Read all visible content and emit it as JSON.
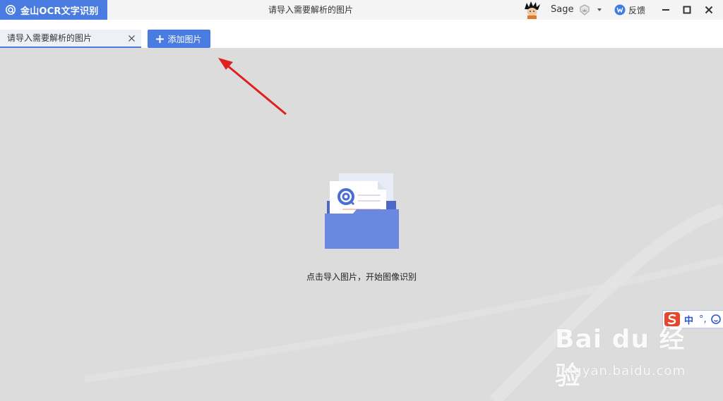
{
  "app": {
    "name": "金山OCR文字识别",
    "window_title": "请导入需要解析的图片"
  },
  "user": {
    "name": "Sage",
    "feedback_label": "反馈"
  },
  "tabs": [
    {
      "label": "请导入需要解析的图片"
    }
  ],
  "toolbar": {
    "add_label": "添加图片"
  },
  "main": {
    "hint": "点击导入图片，开始图像识别"
  },
  "ime": {
    "lang": "中",
    "punct": "°,"
  },
  "watermark": {
    "brand": "Bai du 经验",
    "url": "jingyan.baidu.com"
  },
  "colors": {
    "accent": "#4a7be0",
    "annotation_arrow": "#e02020",
    "folder": "#6b88e0"
  }
}
